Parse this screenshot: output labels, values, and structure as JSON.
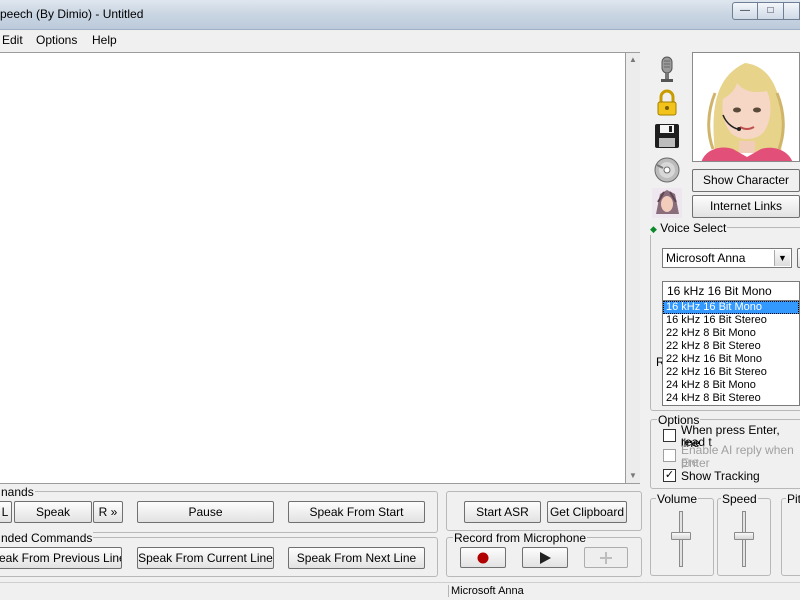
{
  "window": {
    "title": "peech (By Dimio) - Untitled",
    "minimize_glyph": "—",
    "maximize_glyph": "□"
  },
  "menu": [
    "Edit",
    "Options",
    "Help"
  ],
  "commands": {
    "group_label": "nands",
    "left_label": "L",
    "speak_label": "Speak",
    "right_label": "R »",
    "pause_label": "Pause",
    "speak_from_start_label": "Speak From Start"
  },
  "extended": {
    "group_label": "nded Commands",
    "prev_line_label": "eak From Previous Line",
    "current_line_label": "Speak From Current Line",
    "next_line_label": "Speak From Next Line"
  },
  "asr": {
    "start_asr_label": "Start ASR",
    "get_clipboard_label": "Get Clipboard"
  },
  "record": {
    "group_label": "Record from Microphone"
  },
  "character": {
    "show_character_label": "Show Character",
    "internet_links_label": "Internet Links"
  },
  "voice": {
    "group_label": "Voice Select",
    "selected_voice": "Microsoft Anna",
    "format_selected": "16 kHz 16 Bit Mono",
    "format_options": [
      "16 kHz 16 Bit Mono",
      "16 kHz 16 Bit Stereo",
      "22 kHz 8 Bit Mono",
      "22 kHz 8 Bit Stereo",
      "22 kHz 16 Bit Mono",
      "22 kHz 16 Bit Stereo",
      "24 kHz 8 Bit Mono",
      "24 kHz 8 Bit Stereo"
    ],
    "hidden_group_letter": "R"
  },
  "options": {
    "group_label": "Options",
    "enter_read_label_1": "When press Enter, read t",
    "enter_read_label_2": "line",
    "ai_reply_label_1": "Enable AI reply when pre",
    "ai_reply_label_2": "Enter",
    "show_tracking_label": "Show Tracking",
    "show_tracking_mark": "✓"
  },
  "sliders": {
    "volume_label": "Volume",
    "speed_label": "Speed",
    "pitch_label": "Pit"
  },
  "status": {
    "voice_name": "Microsoft Anna"
  },
  "colors": {
    "selection": "#3399ff",
    "record_red": "#b00000"
  }
}
